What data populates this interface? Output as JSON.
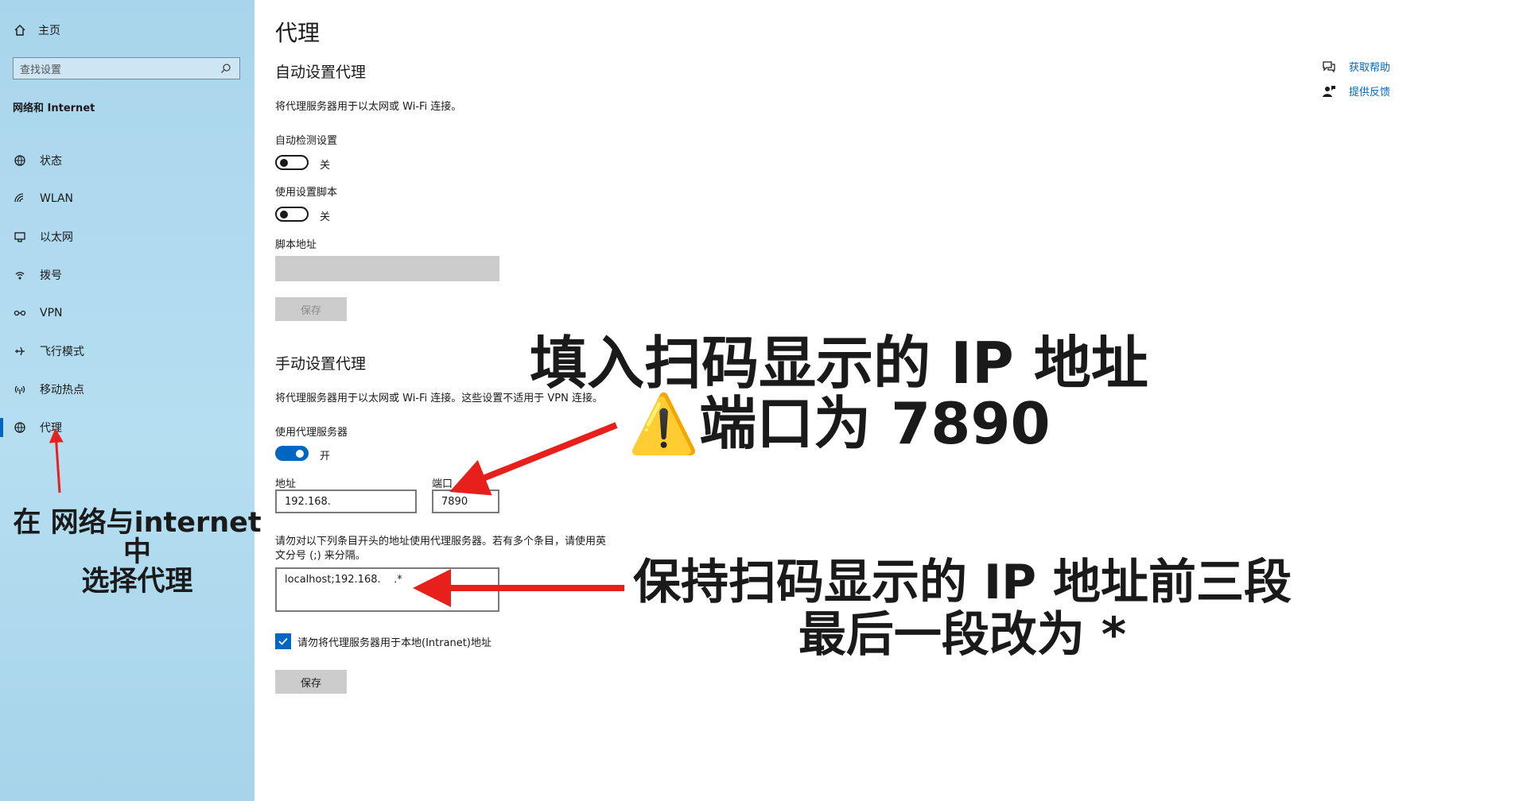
{
  "sidebar": {
    "home_label": "主页",
    "search_placeholder": "查找设置",
    "section_title": "网络和 Internet",
    "items": [
      {
        "label": "状态",
        "icon": "globe-status-icon"
      },
      {
        "label": "WLAN",
        "icon": "wifi-icon"
      },
      {
        "label": "以太网",
        "icon": "ethernet-icon"
      },
      {
        "label": "拨号",
        "icon": "dialup-icon"
      },
      {
        "label": "VPN",
        "icon": "vpn-icon"
      },
      {
        "label": "飞行模式",
        "icon": "airplane-icon"
      },
      {
        "label": "移动热点",
        "icon": "hotspot-icon"
      },
      {
        "label": "代理",
        "icon": "globe-icon",
        "active": true
      }
    ]
  },
  "main": {
    "title": "代理",
    "auto": {
      "heading": "自动设置代理",
      "description": "将代理服务器用于以太网或 Wi-Fi 连接。",
      "detect_label": "自动检测设置",
      "detect_state": "关",
      "script_toggle_label": "使用设置脚本",
      "script_state": "关",
      "script_address_label": "脚本地址",
      "save_label": "保存"
    },
    "manual": {
      "heading": "手动设置代理",
      "description": "将代理服务器用于以太网或 Wi-Fi 连接。这些设置不适用于 VPN 连接。",
      "use_proxy_label": "使用代理服务器",
      "use_proxy_state": "开",
      "address_label": "地址",
      "address_value": "192.168.",
      "port_label": "端口",
      "port_value": "7890",
      "exceptions_note_line1": "请勿对以下列条目开头的地址使用代理服务器。若有多个条目，请使用英",
      "exceptions_note_line2": "文分号 (;) 来分隔。",
      "exceptions_value": "localhost;192.168.    .*",
      "local_checkbox_label": "请勿将代理服务器用于本地(Intranet)地址",
      "local_checkbox_checked": true,
      "save_label": "保存"
    }
  },
  "right_links": [
    {
      "label": "获取帮助",
      "icon": "help-chat-icon"
    },
    {
      "label": "提供反馈",
      "icon": "feedback-icon"
    }
  ],
  "annotations": {
    "ip_line1": "填入扫码显示的 IP 地址",
    "ip_line2": "端口为 7890",
    "ip_line2_icon": "⚠️",
    "keep_line1": "保持扫码显示的 IP 地址前三段",
    "keep_line2": "最后一段改为 *",
    "select_line1": "在 网络与internet 中",
    "select_line2": "选择代理"
  },
  "colors": {
    "accent": "#0067c0",
    "sidebar_bg": "#b0d9ee",
    "arrow": "#e8201c"
  }
}
